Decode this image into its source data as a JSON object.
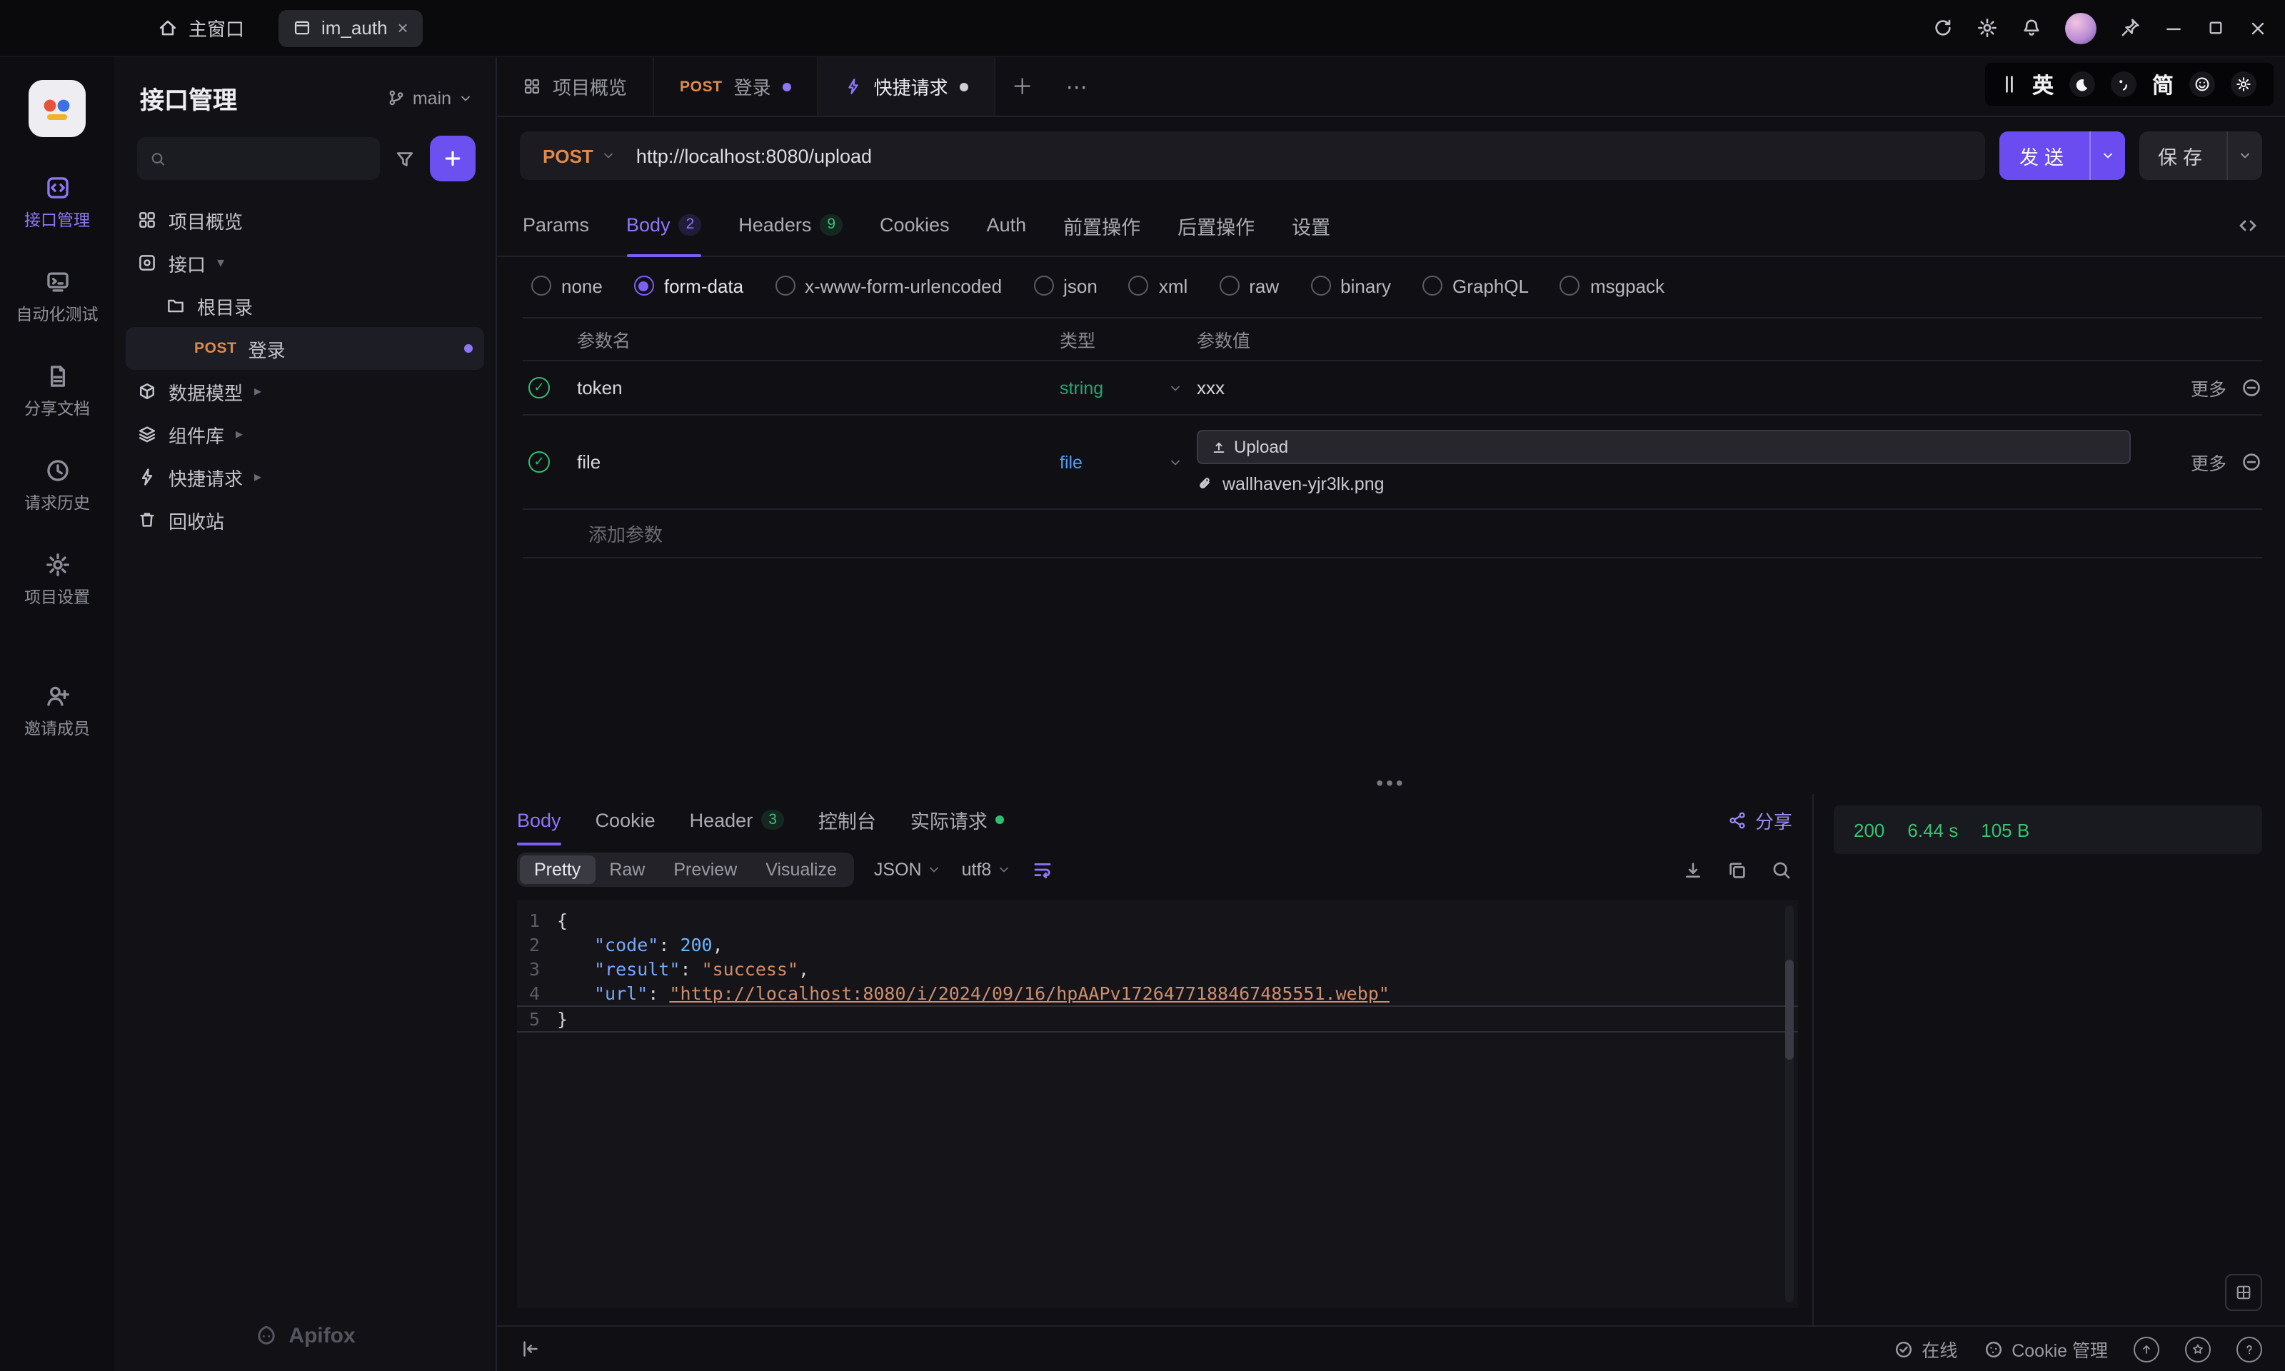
{
  "titlebar": {
    "home": "主窗口",
    "tab": "im_auth"
  },
  "ime": {
    "en": "英",
    "cn": "简"
  },
  "rail": {
    "items": [
      {
        "label": "接口管理"
      },
      {
        "label": "自动化测试"
      },
      {
        "label": "分享文档"
      },
      {
        "label": "请求历史"
      },
      {
        "label": "项目设置"
      },
      {
        "label": "邀请成员"
      }
    ]
  },
  "explorer": {
    "title": "接口管理",
    "branch": "main",
    "brand": "Apifox",
    "tree": {
      "overview": "项目概览",
      "apis": "接口",
      "root": "根目录",
      "login_method": "POST",
      "login_label": "登录",
      "models": "数据模型",
      "components": "组件库",
      "quick": "快捷请求",
      "recycle": "回收站"
    }
  },
  "doc_tabs": [
    {
      "label": "项目概览"
    },
    {
      "method": "POST",
      "label": "登录"
    },
    {
      "label": "快捷请求"
    }
  ],
  "request": {
    "method": "POST",
    "url": "http://localhost:8080/upload",
    "send": "发送",
    "save": "保存",
    "tabs": [
      {
        "label": "Params"
      },
      {
        "label": "Body",
        "badge": "2"
      },
      {
        "label": "Headers",
        "badge": "9"
      },
      {
        "label": "Cookies"
      },
      {
        "label": "Auth"
      },
      {
        "label": "前置操作"
      },
      {
        "label": "后置操作"
      },
      {
        "label": "设置"
      }
    ],
    "body_types": [
      "none",
      "form-data",
      "x-www-form-urlencoded",
      "json",
      "xml",
      "raw",
      "binary",
      "GraphQL",
      "msgpack"
    ],
    "selected_body_type": "form-data",
    "table": {
      "headers": [
        "参数名",
        "类型",
        "参数值"
      ],
      "rows": [
        {
          "name": "token",
          "type": "string",
          "value": "xxx",
          "more": "更多"
        },
        {
          "name": "file",
          "type": "file",
          "upload": "Upload",
          "file": "wallhaven-yjr3lk.png",
          "more": "更多"
        }
      ],
      "add": "添加参数"
    }
  },
  "response": {
    "tabs": [
      {
        "label": "Body"
      },
      {
        "label": "Cookie"
      },
      {
        "label": "Header",
        "badge": "3"
      },
      {
        "label": "控制台"
      },
      {
        "label": "实际请求"
      }
    ],
    "share": "分享",
    "status": "200",
    "time": "6.44 s",
    "size": "105 B",
    "formats": [
      "Pretty",
      "Raw",
      "Preview",
      "Visualize"
    ],
    "lang": "JSON",
    "encoding": "utf8",
    "editor": {
      "l1": {
        "num": "1",
        "text": "{"
      },
      "l2": {
        "num": "2",
        "key": "\"code\"",
        "colon": ": ",
        "val": "200",
        "comma": ","
      },
      "l3": {
        "num": "3",
        "key": "\"result\"",
        "colon": ": ",
        "val": "\"success\"",
        "comma": ","
      },
      "l4": {
        "num": "4",
        "key": "\"url\"",
        "colon": ": ",
        "val": "\"http://localhost:8080/i/2024/09/16/hpAAPv1726477188467485551.webp\""
      },
      "l5": {
        "num": "5",
        "text": "}"
      }
    }
  },
  "statusbar": {
    "online": "在线",
    "cookie": "Cookie 管理"
  }
}
